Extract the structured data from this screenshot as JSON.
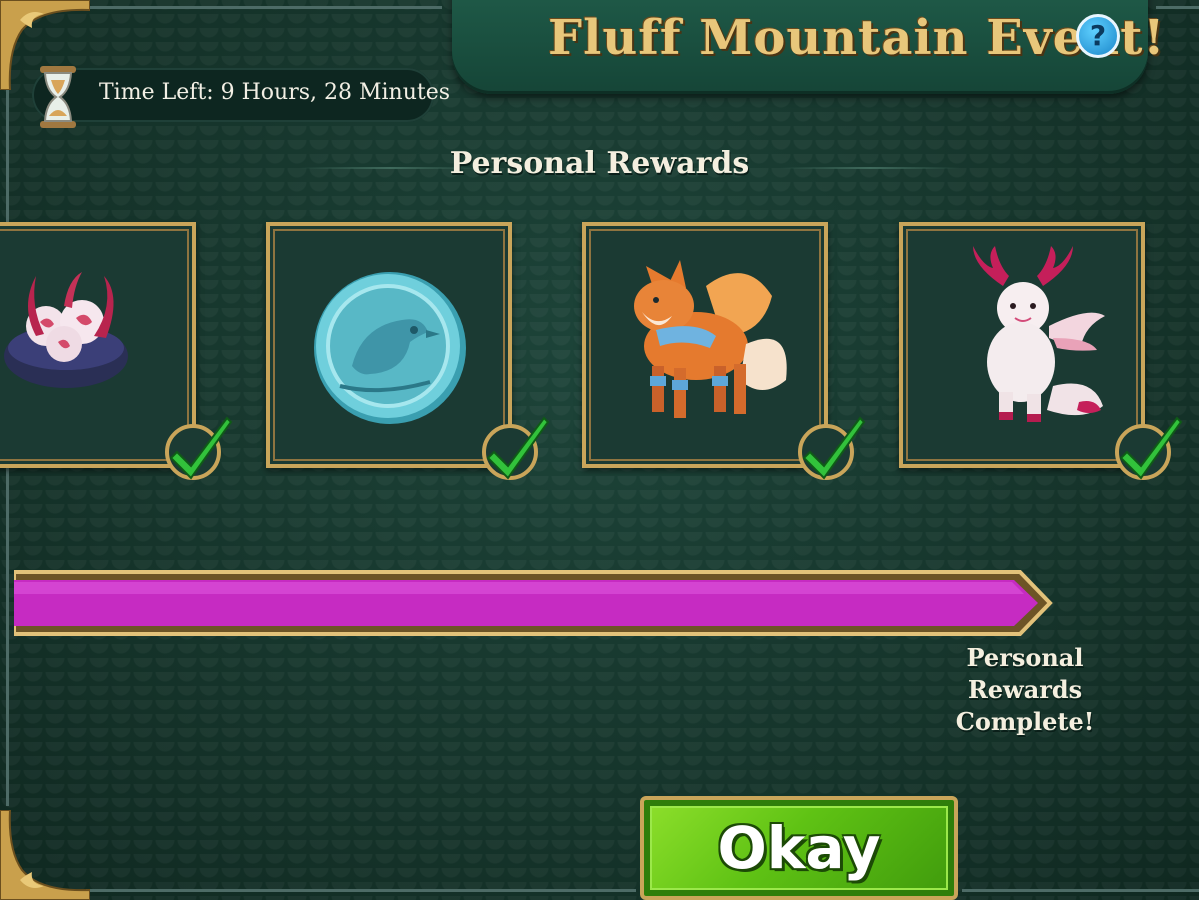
{
  "header": {
    "title": "Fluff Mountain Event!",
    "help_label": "?"
  },
  "timer": {
    "text": "Time Left: 9 Hours, 28 Minutes",
    "icon": "hourglass-icon"
  },
  "rewards": {
    "section_title": "Personal Rewards",
    "items": [
      {
        "name": "dragon-egg-nest",
        "completed": true
      },
      {
        "name": "bird-coin",
        "completed": true
      },
      {
        "name": "winged-fox",
        "completed": true
      },
      {
        "name": "antlered-pink-creature",
        "completed": true
      }
    ]
  },
  "progress": {
    "fraction": 1.0,
    "color": "#c62bc2",
    "status_line1": "Personal Rewards",
    "status_line2": "Complete!"
  },
  "okay_button": {
    "label": "Okay",
    "color": "#5fc214"
  },
  "colors": {
    "background": "#17382f",
    "gold_border": "#c9a55a",
    "title_gold": "#e8c77b",
    "check_green": "#32c23b"
  }
}
